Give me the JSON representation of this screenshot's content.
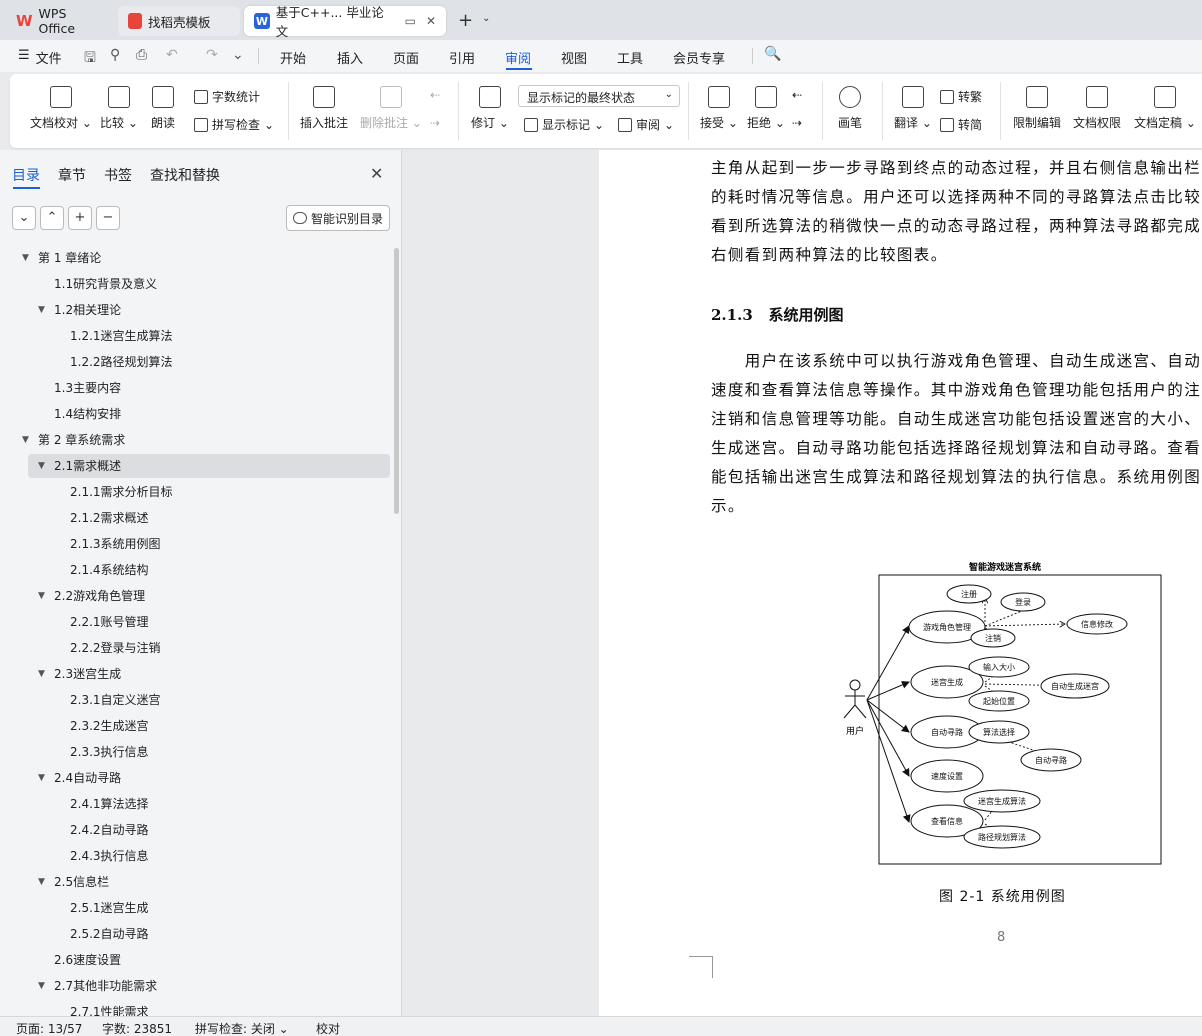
{
  "tabs": {
    "wps": "WPS Office",
    "templates": "找稻壳模板",
    "doc": "基于C++... 毕业论文"
  },
  "menu": {
    "file": "文件",
    "items": [
      "开始",
      "插入",
      "页面",
      "引用",
      "审阅",
      "视图",
      "工具",
      "会员专享"
    ],
    "active": "审阅"
  },
  "ribbon": {
    "doc_check": "文档校对",
    "compare": "比较",
    "read_aloud": "朗读",
    "word_count": "字数统计",
    "spell_check": "拼写检查",
    "insert_comment": "插入批注",
    "delete_comment": "删除批注",
    "track": "修订",
    "markup_state": "显示标记的最终状态",
    "show_markup": "显示标记",
    "review": "审阅",
    "accept": "接受",
    "reject": "拒绝",
    "pen": "画笔",
    "translate": "翻译",
    "to_traditional": "转繁",
    "to_simplified": "转简",
    "restrict_edit": "限制编辑",
    "permission": "文档权限",
    "finalize": "文档定稿"
  },
  "nav": {
    "tabs": [
      "目录",
      "章节",
      "书签",
      "查找和替换"
    ],
    "smart_toc": "智能识别目录",
    "toc": [
      "第 1 章绪论",
      "1.1研究背景及意义",
      "1.2相关理论",
      "1.2.1迷宫生成算法",
      "1.2.2路径规划算法",
      "1.3主要内容",
      "1.4结构安排",
      "第 2 章系统需求",
      "2.1需求概述",
      "2.1.1需求分析目标",
      "2.1.2需求概述",
      "2.1.3系统用例图",
      "2.1.4系统结构",
      "2.2游戏角色管理",
      "2.2.1账号管理",
      "2.2.2登录与注销",
      "2.3迷宫生成",
      "2.3.1自定义迷宫",
      "2.3.2生成迷宫",
      "2.3.3执行信息",
      "2.4自动寻路",
      "2.4.1算法选择",
      "2.4.2自动寻路",
      "2.4.3执行信息",
      "2.5信息栏",
      "2.5.1迷宫生成",
      "2.5.2自动寻路",
      "2.6速度设置",
      "2.7其他非功能需求",
      "2.7.1性能需求"
    ]
  },
  "doc": {
    "para1": [
      "主角从起到一步一步寻路到终点的动态过程，并且右侧信息输出栏",
      "的耗时情况等信息。用户还可以选择两种不同的寻路算法点击比较",
      "看到所选算法的稍微快一点的动态寻路过程，两种算法寻路都完成",
      "右侧看到两种算法的比较图表。"
    ],
    "heading_num": "2.1.3",
    "heading_text": "系统用例图",
    "para2": [
      "　　用户在该系统中可以执行游戏角色管理、自动生成迷宫、自动",
      "速度和查看算法信息等操作。其中游戏角色管理功能包括用户的注",
      "注销和信息管理等功能。自动生成迷宫功能包括设置迷宫的大小、",
      "生成迷宫。自动寻路功能包括选择路径规划算法和自动寻路。查看",
      "能包括输出迷宫生成算法和路径规划算法的执行信息。系统用例图",
      "示。"
    ],
    "figure": {
      "title": "智能游戏迷宫系统",
      "actor": "用户",
      "uc_role": "游戏角色管理",
      "uc_register": "注册",
      "uc_login": "登录",
      "uc_info_edit": "信息修改",
      "uc_logout": "注销",
      "uc_maze": "迷宫生成",
      "uc_size": "输入大小",
      "uc_auto_maze": "自动生成迷宫",
      "uc_start": "起始位置",
      "uc_path": "自动寻路",
      "uc_algo": "算法选择",
      "uc_auto_path": "自动寻路",
      "uc_speed": "速度设置",
      "uc_info": "查看信息",
      "uc_maze_algo": "迷宫生成算法",
      "uc_path_algo": "路径规划算法"
    },
    "caption": "图 2-1  系统用例图",
    "page_number": "8"
  },
  "status": {
    "page": "页面: 13/57",
    "words": "字数: 23851",
    "spell": "拼写检查: 关闭",
    "proof": "校对"
  }
}
